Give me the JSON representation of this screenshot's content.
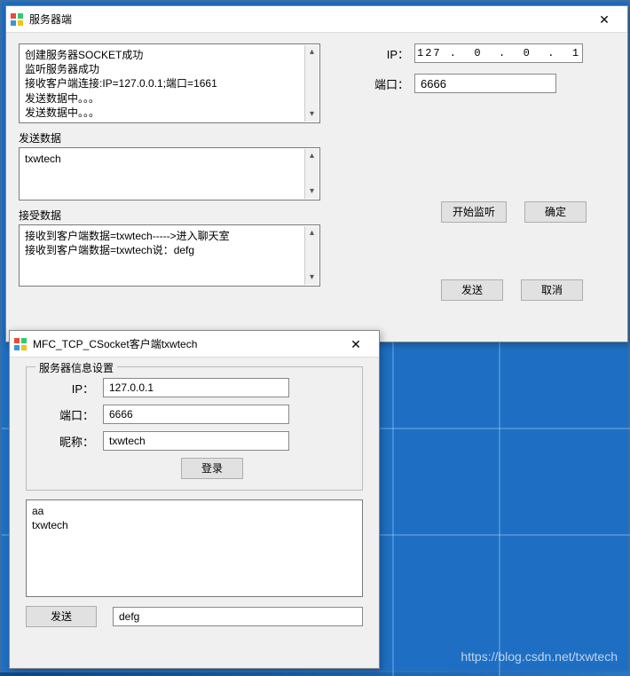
{
  "server": {
    "title": "服务器端",
    "log_lines": "创建服务器SOCKET成功\n监听服务器成功\n接收客户端连接:IP=127.0.0.1;端口=1661\n发送数据中。。。\n发送数据中。。。",
    "send_label": "发送数据",
    "send_text": "txwtech",
    "recv_label": "接受数据",
    "recv_lines": "接收到客户端数据=txwtech----->进入聊天室\n接收到客户端数据=txwtech说：defg",
    "ip_label": "IP：",
    "ip_value": "127 .  0  .  0  .  1",
    "port_label": "端口：",
    "port_value": "6666",
    "btn_listen": "开始监听",
    "btn_ok": "确定",
    "btn_send": "发送",
    "btn_cancel": "取消"
  },
  "client": {
    "title": "MFC_TCP_CSocket客户端txwtech",
    "group_title": "服务器信息设置",
    "ip_label": "IP：",
    "ip_value": "127.0.0.1",
    "port_label": "端口：",
    "port_value": "6666",
    "nick_label": "昵称：",
    "nick_value": "txwtech",
    "btn_login": "登录",
    "msg_lines": "aa\ntxwtech",
    "btn_send": "发送",
    "send_value": "defg"
  },
  "watermark": "https://blog.csdn.net/txwtech"
}
